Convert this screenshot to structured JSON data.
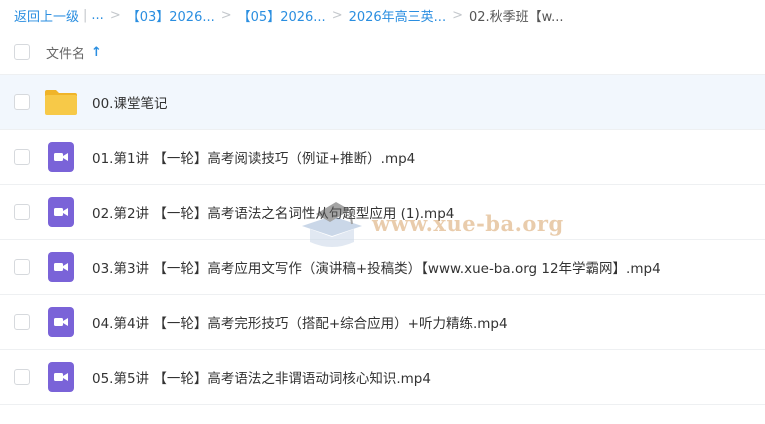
{
  "breadcrumb": {
    "back": "返回上一级",
    "ellipsis": "...",
    "items": [
      "【03】2026...",
      "【05】2026...",
      "2026年高三英..."
    ],
    "current": "02.秋季班【w..."
  },
  "table_header": {
    "name_label": "文件名",
    "sort_indicator": "arrow-up-icon"
  },
  "files": [
    {
      "name": "00.课堂笔记",
      "type": "folder",
      "icon": "folder-icon"
    },
    {
      "name": "01.第1讲 【一轮】高考阅读技巧（例证+推断）.mp4",
      "type": "video",
      "icon": "video-icon"
    },
    {
      "name": "02.第2讲 【一轮】高考语法之名词性从句题型应用 (1).mp4",
      "type": "video",
      "icon": "video-icon"
    },
    {
      "name": "03.第3讲 【一轮】高考应用文写作（演讲稿+投稿类）【www.xue-ba.org 12年学霸网】.mp4",
      "type": "video",
      "icon": "video-icon"
    },
    {
      "name": "04.第4讲 【一轮】高考完形技巧（搭配+综合应用）+听力精练.mp4",
      "type": "video",
      "icon": "video-icon"
    },
    {
      "name": "05.第5讲 【一轮】高考语法之非谓语动词核心知识.mp4",
      "type": "video",
      "icon": "video-icon"
    }
  ],
  "watermark": {
    "text": "www.xue-ba.org"
  },
  "colors": {
    "link": "#2a8ee0",
    "folder": "#f7c948",
    "video": "#7a63d8",
    "selected_row": "#f2f7fd"
  }
}
